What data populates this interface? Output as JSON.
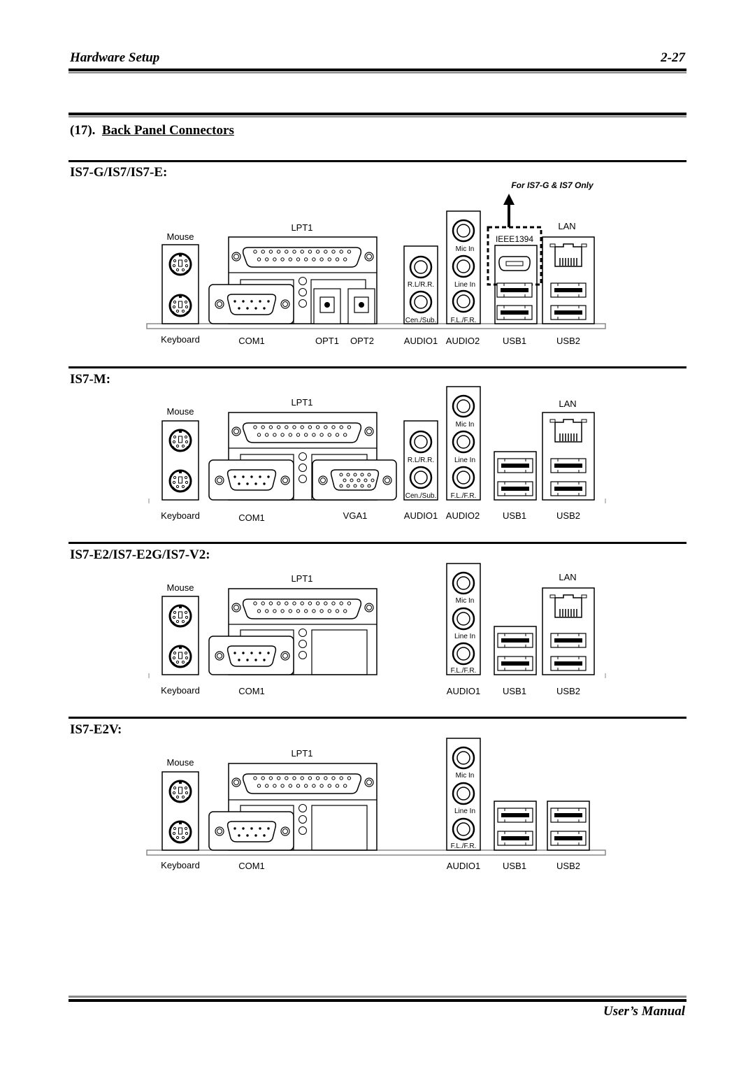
{
  "header": {
    "title": "Hardware Setup",
    "page_number": "2-27"
  },
  "section": {
    "number": "(17).",
    "title": "Back Panel Connectors"
  },
  "note": "For IS7-G & IS7 Only",
  "diagrams": [
    {
      "model": "IS7-G/IS7/IS7-E:",
      "labels": {
        "mouse": "Mouse",
        "keyboard": "Keyboard",
        "lpt": "LPT1",
        "com": "COM1",
        "opt1": "OPT1",
        "opt2": "OPT2",
        "audio1": "AUDIO1",
        "audio2": "AUDIO2",
        "usb1": "USB1",
        "usb2": "USB2",
        "lan": "LAN",
        "ieee": "IEEE1394",
        "rlrr": "R.L/R.R.",
        "censub": "Cen./Sub.",
        "micin": "Mic In",
        "linein": "Line In",
        "flfr": "F.L./F.R."
      }
    },
    {
      "model": "IS7-M:",
      "labels": {
        "mouse": "Mouse",
        "keyboard": "Keyboard",
        "lpt": "LPT1",
        "com": "COM1",
        "vga": "VGA1",
        "audio1": "AUDIO1",
        "audio2": "AUDIO2",
        "usb1": "USB1",
        "usb2": "USB2",
        "lan": "LAN",
        "rlrr": "R.L/R.R.",
        "censub": "Cen./Sub.",
        "micin": "Mic In",
        "linein": "Line In",
        "flfr": "F.L./F.R."
      }
    },
    {
      "model": "IS7-E2/IS7-E2G/IS7-V2:",
      "labels": {
        "mouse": "Mouse",
        "keyboard": "Keyboard",
        "lpt": "LPT1",
        "com": "COM1",
        "audio1": "AUDIO1",
        "usb1": "USB1",
        "usb2": "USB2",
        "lan": "LAN",
        "micin": "Mic In",
        "linein": "Line In",
        "flfr": "F.L./F.R."
      }
    },
    {
      "model": "IS7-E2V:",
      "labels": {
        "mouse": "Mouse",
        "keyboard": "Keyboard",
        "lpt": "LPT1",
        "com": "COM1",
        "audio1": "AUDIO1",
        "usb1": "USB1",
        "usb2": "USB2",
        "micin": "Mic In",
        "linein": "Line In",
        "flfr": "F.L./F.R."
      }
    }
  ],
  "footer": {
    "title": "User’s Manual"
  }
}
